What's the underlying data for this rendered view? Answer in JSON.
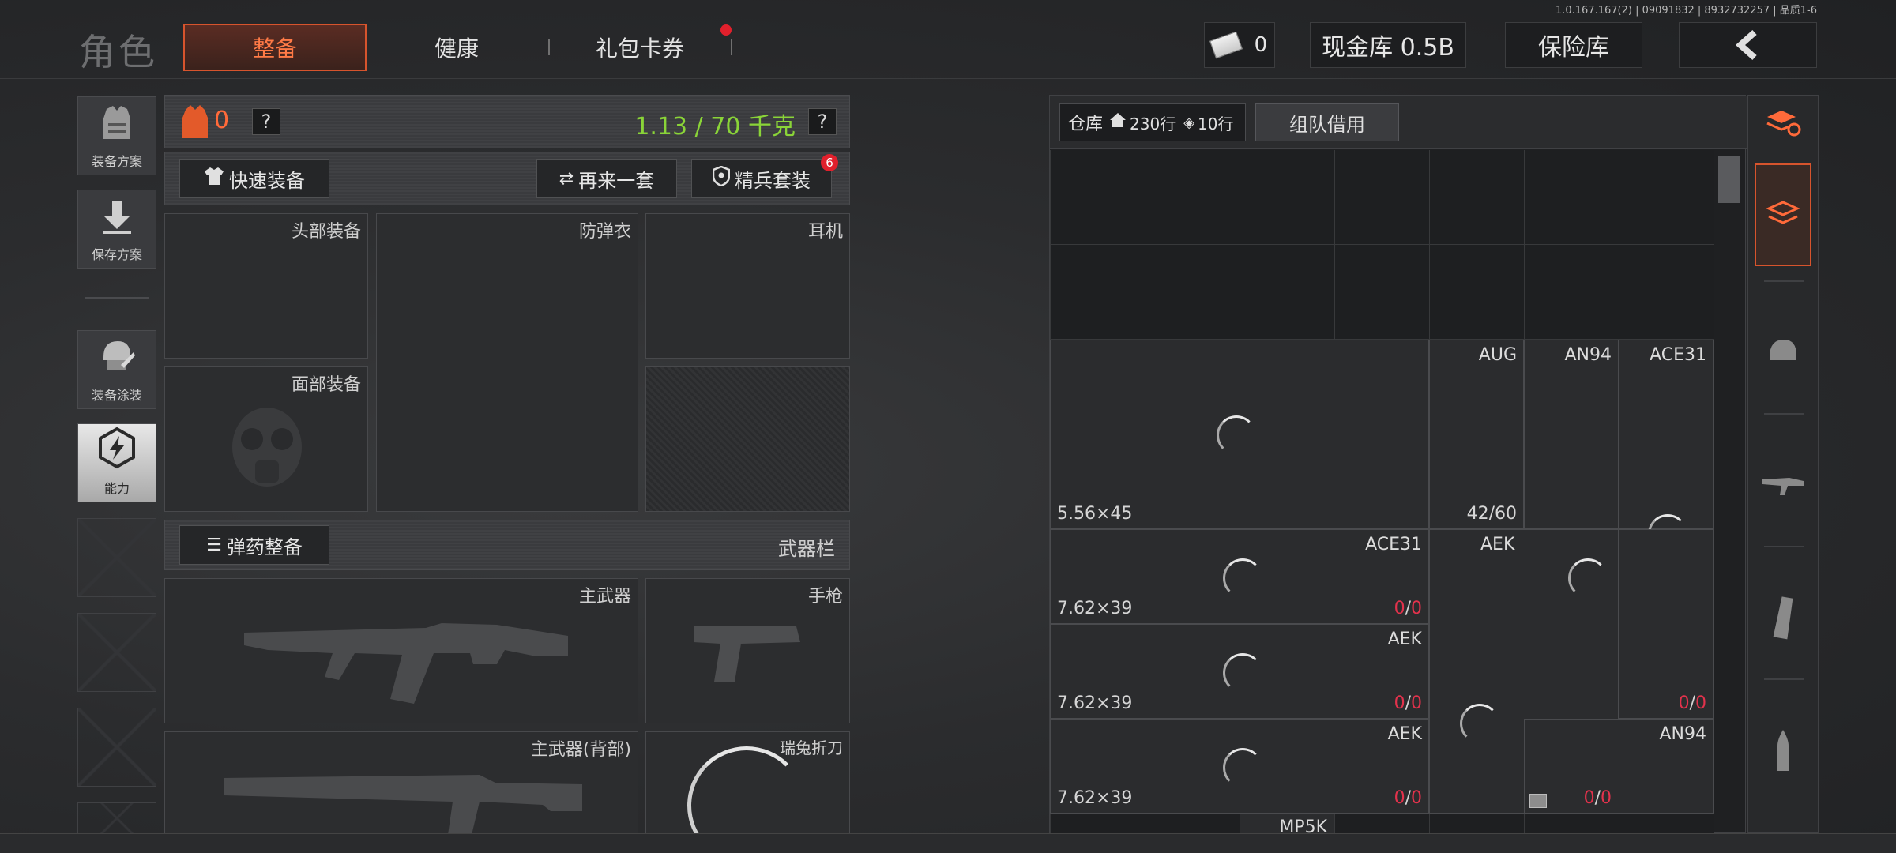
{
  "build_info": "1.0.167.167(2) | 09091832 | 8932732257 | 品质1-6",
  "header": {
    "title": "角色",
    "tabs": [
      {
        "label": "整备",
        "active": true
      },
      {
        "label": "健康",
        "active": false
      },
      {
        "label": "礼包卡券",
        "active": false,
        "notification_dot": true
      }
    ],
    "currency_value": "0",
    "cash_vault": "现金库 0.5B",
    "safe_label": "保险库",
    "back_icon": "chevron-left-icon"
  },
  "left_nav": [
    {
      "label": "装备方案",
      "icon": "vest-icon"
    },
    {
      "label": "保存方案",
      "icon": "download-icon"
    },
    {
      "label": "装备涂装",
      "icon": "helmet-paint-icon"
    },
    {
      "label": "能力",
      "icon": "lightning-hex-icon",
      "active": true
    }
  ],
  "equipment": {
    "armor_count": "0",
    "weight": "1.13 / 70 千克",
    "quick_equip": "快速装备",
    "repeat_set": "再来一套",
    "elite_set": "精兵套装",
    "elite_badge": "6",
    "slots": {
      "head": "头部装备",
      "vest": "防弹衣",
      "earphone": "耳机",
      "face": "面部装备"
    },
    "ammo_prep": "弹药整备",
    "weapon_bar": "武器栏",
    "weapons": {
      "primary": "主武器",
      "pistol": "手枪",
      "primary_back": "主武器(背部)",
      "knife": "瑞兔折刀"
    }
  },
  "warehouse": {
    "label": "仓库",
    "rows_home": "230行",
    "rows_tag": "10行",
    "team_borrow": "组队借用",
    "items": [
      {
        "id": "ammo-556",
        "caliber": "5.56×45",
        "names": [
          "AUG",
          "AN94",
          "ACE31"
        ],
        "count": "42/60"
      },
      {
        "id": "ammo-762-a",
        "caliber": "7.62×39",
        "name": "ACE31",
        "count_a": "0",
        "count_b": "0"
      },
      {
        "id": "aek-top",
        "name": "AEK"
      },
      {
        "id": "ammo-762-b",
        "caliber": "7.62×39",
        "name": "AEK",
        "count_a": "0",
        "count_b": "0"
      },
      {
        "id": "ammo-762-c",
        "caliber": "7.62×39",
        "name": "AEK",
        "count_a": "0",
        "count_b": "0"
      },
      {
        "id": "right-mid",
        "count_a": "0",
        "count_b": "0"
      },
      {
        "id": "right-bottom",
        "name": "AN94",
        "count_a": "0",
        "count_b": "0"
      },
      {
        "id": "mp5k",
        "name": "MP5K"
      }
    ]
  }
}
